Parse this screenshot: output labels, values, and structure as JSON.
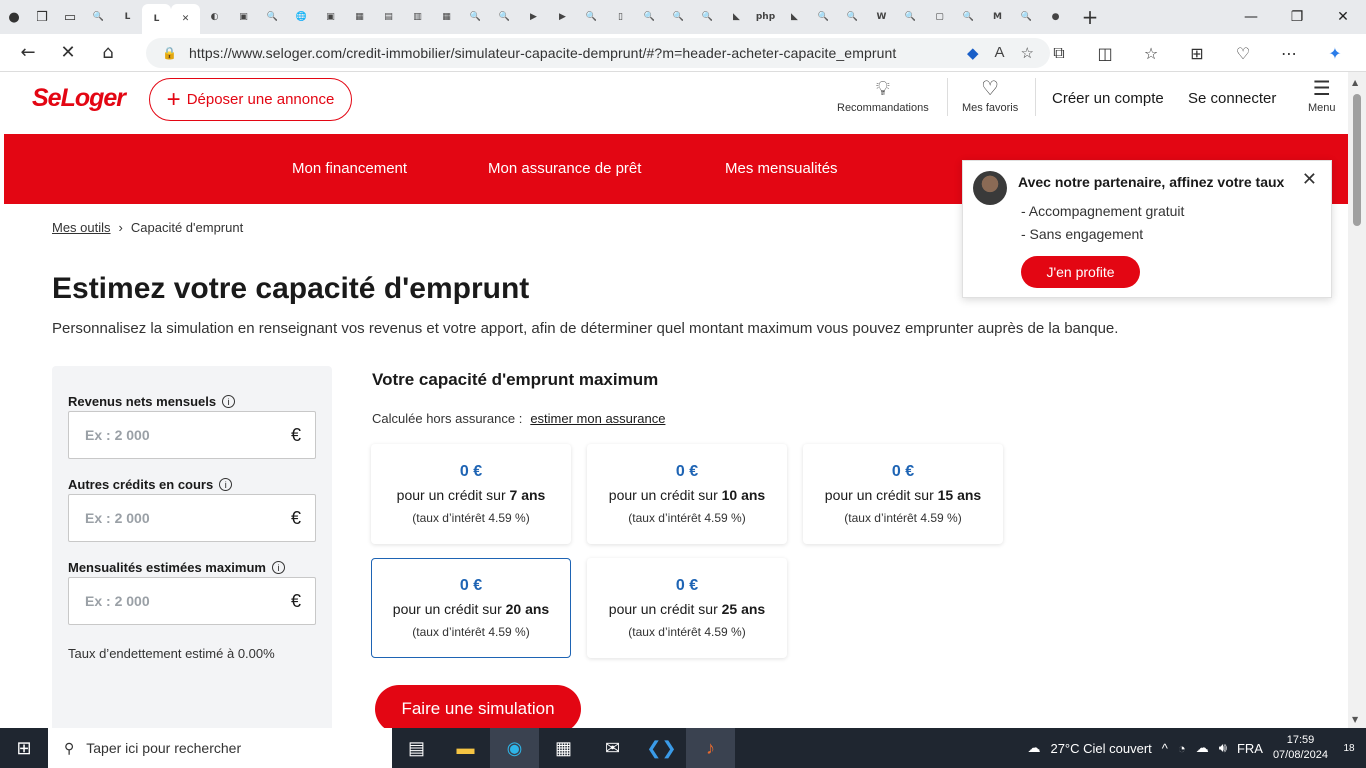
{
  "browser": {
    "tabs": [
      {
        "name": "tab-search-1",
        "glyph": "🔍"
      },
      {
        "name": "tab-linkedin-1",
        "glyph": "L"
      },
      {
        "name": "tab-linkedin-2",
        "glyph": "L"
      },
      {
        "name": "tab-close",
        "glyph": "✕"
      },
      {
        "name": "tab-edge",
        "glyph": "◐"
      },
      {
        "name": "tab-doc-1",
        "glyph": "▣"
      },
      {
        "name": "tab-search-2",
        "glyph": "🔍"
      },
      {
        "name": "tab-globe",
        "glyph": "🌐"
      },
      {
        "name": "tab-doc-2",
        "glyph": "▣"
      },
      {
        "name": "tab-doc-3",
        "glyph": "▦"
      },
      {
        "name": "tab-doc-4",
        "glyph": "▤"
      },
      {
        "name": "tab-pdf",
        "glyph": "▥"
      },
      {
        "name": "tab-app",
        "glyph": "▦"
      },
      {
        "name": "tab-search-3",
        "glyph": "🔍"
      },
      {
        "name": "tab-search-4",
        "glyph": "🔍"
      },
      {
        "name": "tab-youtube-1",
        "glyph": "▶"
      },
      {
        "name": "tab-youtube-2",
        "glyph": "▶"
      },
      {
        "name": "tab-search-5",
        "glyph": "🔍"
      },
      {
        "name": "tab-file",
        "glyph": "▯"
      },
      {
        "name": "tab-search-6",
        "glyph": "🔍"
      },
      {
        "name": "tab-search-7",
        "glyph": "🔍"
      },
      {
        "name": "tab-search-8",
        "glyph": "🔍"
      },
      {
        "name": "tab-pma-1",
        "glyph": "◣"
      },
      {
        "name": "tab-php",
        "glyph": "php"
      },
      {
        "name": "tab-pma-2",
        "glyph": "◣"
      },
      {
        "name": "tab-search-9",
        "glyph": "🔍"
      },
      {
        "name": "tab-search-10",
        "glyph": "🔍"
      },
      {
        "name": "tab-wikipedia",
        "glyph": "W"
      },
      {
        "name": "tab-search-11",
        "glyph": "🔍"
      },
      {
        "name": "tab-puzzle",
        "glyph": "▢"
      },
      {
        "name": "tab-search-12",
        "glyph": "🔍"
      },
      {
        "name": "tab-gmail",
        "glyph": "M"
      },
      {
        "name": "tab-search-13",
        "glyph": "🔍"
      },
      {
        "name": "tab-github",
        "glyph": "●"
      }
    ],
    "new_tab": "+",
    "minimize": "—",
    "maximize": "❐",
    "close": "✕",
    "url": "https://www.seloger.com/credit-immobilier/simulateur-capacite-demprunt/#?m=header-acheter-capacite_emprunt"
  },
  "header": {
    "logo": "SeLoger",
    "deposer": "Déposer une annonce",
    "recommandations": "Recommandations",
    "favoris": "Mes favoris",
    "creer_compte": "Créer un compte",
    "connecter": "Se connecter",
    "menu": "Menu"
  },
  "nav": {
    "financement": "Mon financement",
    "assurance": "Mon assurance de prêt",
    "mensualites": "Mes mensualités"
  },
  "breadcrumb": {
    "parent": "Mes outils",
    "current": "Capacité d'emprunt"
  },
  "page": {
    "title": "Estimez votre capacité d'emprunt",
    "subtitle": "Personnalisez la simulation en renseignant vos revenus et votre apport, afin de déterminer quel montant maximum vous pouvez emprunter auprès de la banque."
  },
  "form": {
    "revenus_label": "Revenus nets mensuels",
    "revenus_placeholder": "Ex : 2 000",
    "credits_label": "Autres crédits en cours",
    "credits_placeholder": "Ex : 2 000",
    "mensualites_label": "Mensualités estimées maximum",
    "mensualites_placeholder": "Ex : 2 000",
    "currency": "€",
    "info": "i",
    "taux_endettement": "Taux d’endettement estimé à 0.00%"
  },
  "results": {
    "title": "Votre capacité d'emprunt maximum",
    "calc_prefix": "Calculée hors assurance :",
    "calc_link": "estimer mon assurance",
    "cards": [
      {
        "amount": "0 €",
        "prefix": "pour un crédit sur ",
        "years": "7 ans",
        "rate": "(taux d’intérêt 4.59 %)"
      },
      {
        "amount": "0 €",
        "prefix": "pour un crédit sur ",
        "years": "10 ans",
        "rate": "(taux d’intérêt 4.59 %)"
      },
      {
        "amount": "0 €",
        "prefix": "pour un crédit sur ",
        "years": "15 ans",
        "rate": "(taux d’intérêt 4.59 %)"
      },
      {
        "amount": "0 €",
        "prefix": "pour un crédit sur ",
        "years": "20 ans",
        "rate": "(taux d’intérêt 4.59 %)"
      },
      {
        "amount": "0 €",
        "prefix": "pour un crédit sur ",
        "years": "25 ans",
        "rate": "(taux d’intérêt 4.59 %)"
      }
    ],
    "simulate_button": "Faire une simulation"
  },
  "popup": {
    "title": "Avec notre partenaire, affinez votre taux",
    "bullet1": "- Accompagnement gratuit",
    "bullet2": "- Sans engagement",
    "cta": "J'en profite"
  },
  "taskbar": {
    "search_placeholder": "Taper ici pour rechercher",
    "weather": "27°C  Ciel couvert",
    "language": "FRA",
    "time": "17:59",
    "date": "07/08/2024",
    "notifications": "18"
  },
  "colors": {
    "brand_red": "#e30613",
    "accent_blue": "#1e64b4"
  }
}
